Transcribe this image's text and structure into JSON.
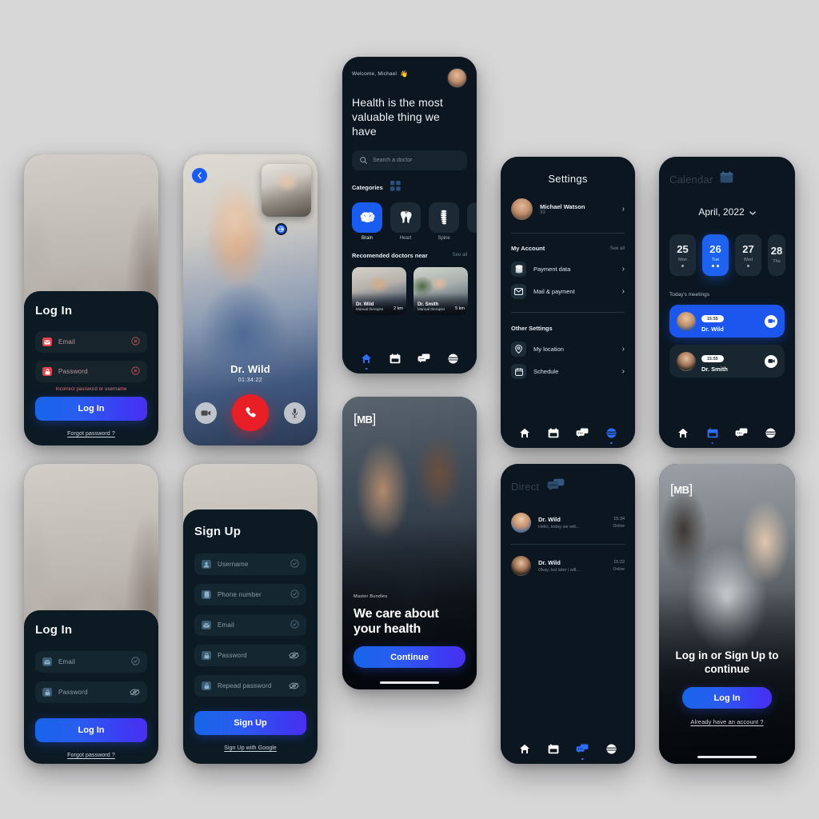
{
  "meta": {
    "background_color": "#d7d7d8",
    "accent_blue": "#1a5cf0",
    "danger_red": "#e4434c"
  },
  "login_error": {
    "title": "Log In",
    "email_placeholder": "Email",
    "password_placeholder": "Password",
    "error_message": "Incorrect password or username",
    "submit_label": "Log In",
    "forgot_label": "Forgot password ?"
  },
  "login_plain": {
    "title": "Log In",
    "email_placeholder": "Email",
    "password_placeholder": "Password",
    "submit_label": "Log In",
    "forgot_label": "Forgot password ?"
  },
  "call": {
    "doctor_name": "Dr. Wild",
    "duration": "01:34:22",
    "back_icon": "chevron-left-icon",
    "switch_camera_icon": "switch-camera-icon",
    "video_icon": "video-camera-icon",
    "hangup_icon": "phone-icon",
    "mic_icon": "microphone-icon"
  },
  "home": {
    "welcome": "Welcome, Michael",
    "welcome_emoji": "👋",
    "headline": "Health is the most valuable thing we have",
    "search_placeholder": "Search a doctor",
    "categories_label": "Categories",
    "grid_icon": "grid-icon",
    "categories": [
      {
        "name": "Brain",
        "icon": "brain-icon",
        "active": true
      },
      {
        "name": "Heart",
        "icon": "heart-icon",
        "active": false
      },
      {
        "name": "Spine",
        "icon": "spine-icon",
        "active": false
      }
    ],
    "recommended_label": "Recomended doctors near",
    "see_all": "See all",
    "doctors": [
      {
        "name": "Dr. Wild",
        "role": "Manual therapist",
        "distance": "2 km"
      },
      {
        "name": "Dr. Smith",
        "role": "Manual therapist",
        "distance": "5 km"
      }
    ]
  },
  "settings": {
    "title": "Settings",
    "profile": {
      "name": "Michael Watson",
      "age": "33"
    },
    "section_account": "My Account",
    "see_all": "See all",
    "account_items": [
      {
        "label": "Payment data",
        "icon": "database-icon"
      },
      {
        "label": "Mail & payment",
        "icon": "mail-icon"
      }
    ],
    "section_other": "Other Settings",
    "other_items": [
      {
        "label": "My location",
        "icon": "location-pin-icon"
      },
      {
        "label": "Schedule",
        "icon": "calendar-icon"
      }
    ]
  },
  "calendar": {
    "title": "Calendar",
    "title_icon": "calendar-icon",
    "month": "April, 2022",
    "dropdown_icon": "chevron-down-icon",
    "days": [
      {
        "num": "25",
        "weekday": "Mon",
        "dots": 1,
        "active": false
      },
      {
        "num": "26",
        "weekday": "Tue",
        "dots": 2,
        "active": true
      },
      {
        "num": "27",
        "weekday": "Wed",
        "dots": 1,
        "active": false
      },
      {
        "num": "28",
        "weekday": "Thu",
        "dots": 0,
        "active": false
      }
    ],
    "meetings_label": "Today's meetings",
    "meetings": [
      {
        "time": "15:55",
        "name": "Dr. Wild",
        "active": true,
        "action_icon": "video-camera-icon"
      },
      {
        "time": "15:55",
        "name": "Dr. Smith",
        "active": false,
        "action_icon": "video-camera-icon"
      }
    ]
  },
  "direct": {
    "title": "Direct",
    "title_icon": "chat-bubbles-icon",
    "threads": [
      {
        "name": "Dr. Wild",
        "preview": "Hello, today we will...",
        "time": "15:34",
        "status": "Online"
      },
      {
        "name": "Dr. Wild",
        "preview": "Okay, but later i will...",
        "time": "15:22",
        "status": "Online"
      }
    ]
  },
  "signup": {
    "title": "Sign Up",
    "fields": [
      {
        "placeholder": "Username",
        "icon": "user-icon",
        "right_icon": "check-circle-icon"
      },
      {
        "placeholder": "Phone number",
        "icon": "phone-icon",
        "right_icon": "check-circle-icon"
      },
      {
        "placeholder": "Email",
        "icon": "mail-icon",
        "right_icon": "check-circle-icon"
      },
      {
        "placeholder": "Password",
        "icon": "lock-icon",
        "right_icon": "eye-off-icon"
      },
      {
        "placeholder": "Repead password",
        "icon": "lock-icon",
        "right_icon": "eye-off-icon"
      }
    ],
    "submit_label": "Sign Up",
    "google_label": "Sign Up with Google"
  },
  "onboarding_care": {
    "logo": "MB",
    "kicker": "Master Bundles",
    "headline": "We care about your health",
    "cta_label": "Continue"
  },
  "onboarding_auth": {
    "logo": "MB",
    "headline": "Log in or Sign Up to continue",
    "cta_label": "Log In",
    "secondary_label": "Already have an account ?"
  },
  "nav": {
    "items": [
      {
        "name": "home",
        "icon": "home-icon"
      },
      {
        "name": "calendar",
        "icon": "calendar-icon"
      },
      {
        "name": "messages",
        "icon": "chat-bubbles-icon"
      },
      {
        "name": "profile",
        "icon": "profile-icon"
      }
    ]
  }
}
